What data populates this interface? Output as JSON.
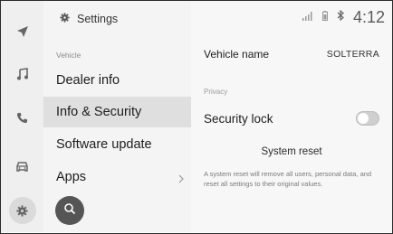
{
  "rail": {
    "items": [
      {
        "icon": "navigation-arrow-icon"
      },
      {
        "icon": "music-note-icon"
      },
      {
        "icon": "phone-icon"
      },
      {
        "icon": "car-icon"
      },
      {
        "icon": "settings-gear-icon",
        "active": true
      }
    ]
  },
  "list": {
    "header_icon": "settings-gear-icon",
    "header_title": "Settings",
    "section_vehicle": "Vehicle",
    "items": [
      {
        "label": "Dealer info"
      },
      {
        "label": "Info & Security",
        "selected": true
      },
      {
        "label": "Software update"
      },
      {
        "label": "Apps",
        "has_chevron": true
      }
    ],
    "search_icon": "search-icon"
  },
  "status_bar": {
    "icons": [
      "signal-bars-icon",
      "battery-icon",
      "bluetooth-icon"
    ],
    "time": "4:12"
  },
  "detail": {
    "vehicle_name_label": "Vehicle name",
    "vehicle_name_value": "SOLTERRA",
    "privacy_section": "Privacy",
    "security_lock_label": "Security lock",
    "security_lock_on": false,
    "system_reset_title": "System reset",
    "system_reset_description": "A system reset will remove all users, personal data, and reset all settings to their original values."
  },
  "colors": {
    "rail_bg": "#efefef",
    "list_bg": "#f4f4f4",
    "selected_row": "#dfdfdf",
    "panel_bg": "#f7f7f7",
    "fab": "#555555"
  }
}
